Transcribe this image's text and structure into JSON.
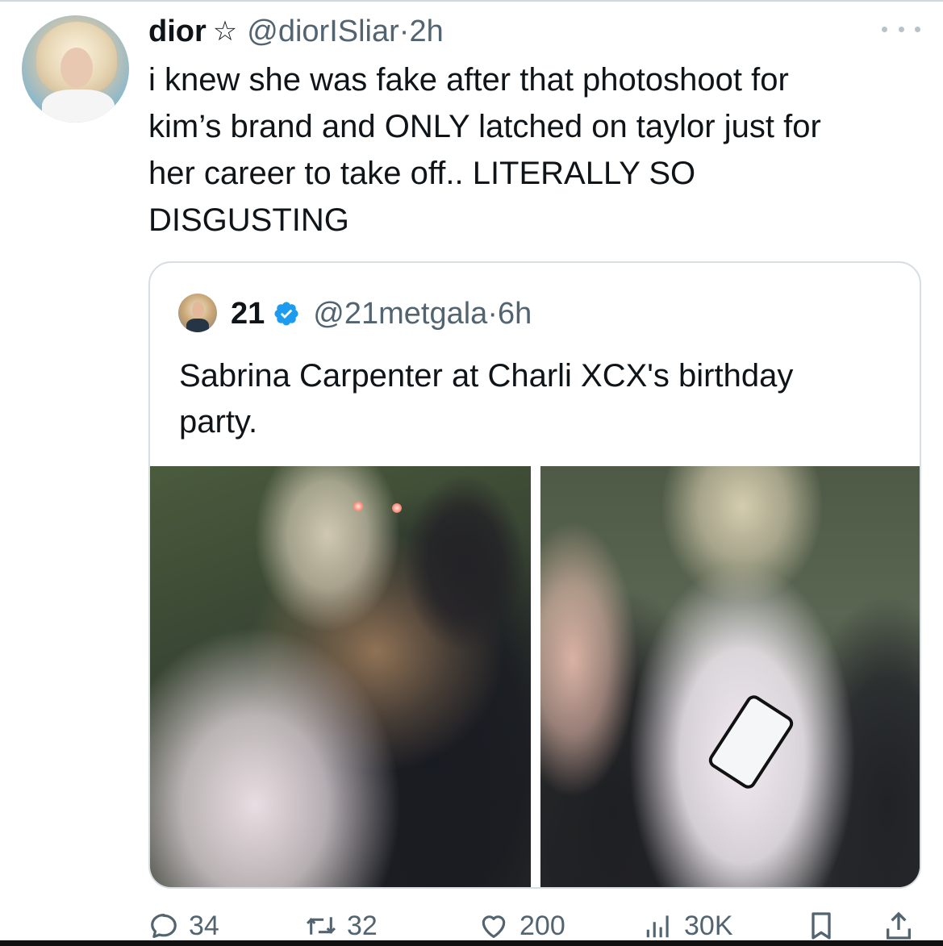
{
  "tweet": {
    "display_name": "dior",
    "name_badge_icon": "star-outline-icon",
    "handle": "@diorISliar",
    "timestamp": "2h",
    "separator": "·",
    "more_icon": "more-dots-icon",
    "text": "i knew she was fake after that photoshoot for\nkim’s brand and ONLY latched on taylor just for\nher career to take off.. LITERALLY SO\nDISGUSTING"
  },
  "quote": {
    "display_name": "21",
    "verified_icon": "verified-badge-icon",
    "verified_color": "#1d9bf0",
    "handle": "@21metgala",
    "timestamp": "6h",
    "separator": "·",
    "text": "Sabrina Carpenter at Charli XCX's birthday\nparty.",
    "images": [
      {
        "name": "party-photo-left"
      },
      {
        "name": "party-photo-right"
      }
    ]
  },
  "actions": {
    "reply": {
      "icon": "reply-bubble-icon",
      "count": "34"
    },
    "retweet": {
      "icon": "retweet-arrows-icon",
      "count": "32"
    },
    "like": {
      "icon": "heart-icon",
      "count": "200"
    },
    "views": {
      "icon": "bar-chart-icon",
      "count": "30K"
    },
    "bookmark": {
      "icon": "bookmark-icon"
    },
    "share": {
      "icon": "share-upload-icon"
    }
  },
  "colors": {
    "text_primary": "#0f1419",
    "text_secondary": "#536471",
    "border": "#d7dee3"
  }
}
